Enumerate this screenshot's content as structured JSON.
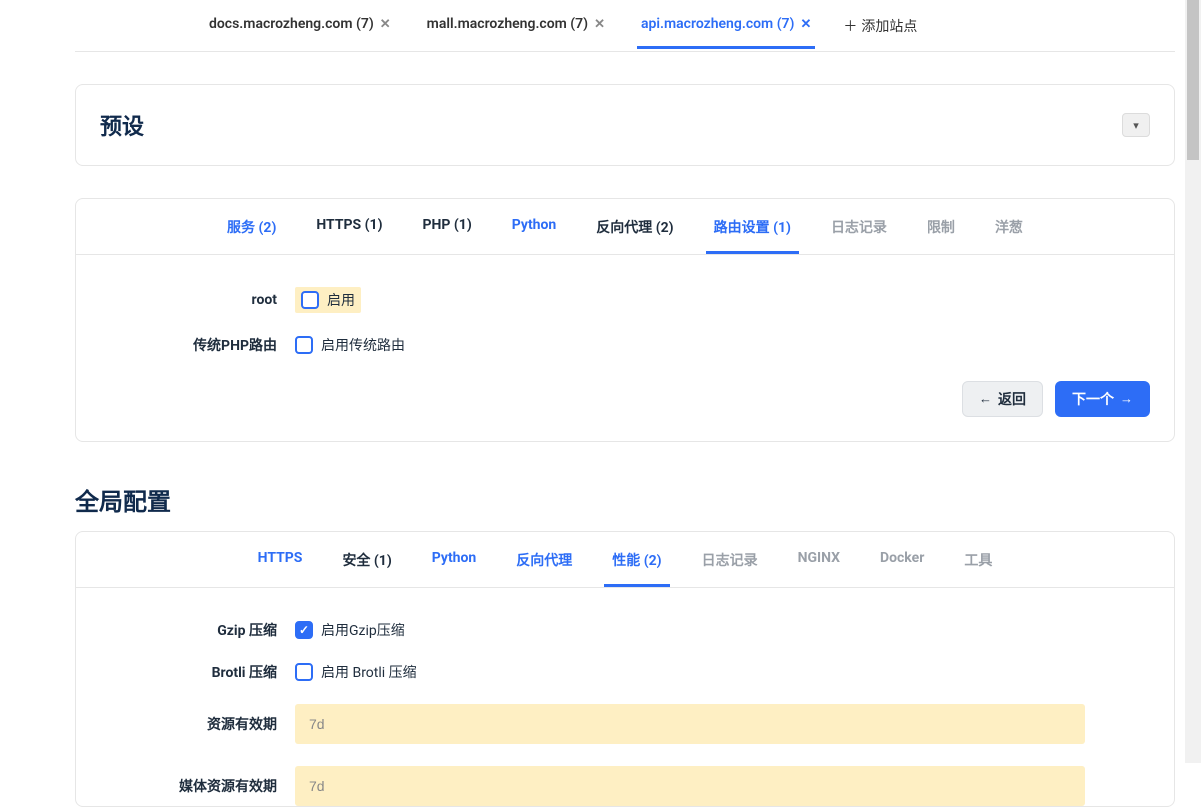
{
  "siteTabs": {
    "items": [
      {
        "label": "docs.macrozheng.com (7)",
        "active": false
      },
      {
        "label": "mall.macrozheng.com (7)",
        "active": false
      },
      {
        "label": "api.macrozheng.com (7)",
        "active": true
      }
    ],
    "addLabel": "添加站点"
  },
  "presetCard": {
    "title": "预设",
    "tabs": [
      {
        "label": "服务 (2)",
        "style": "link"
      },
      {
        "label": "HTTPS (1)",
        "style": "normal"
      },
      {
        "label": "PHP (1)",
        "style": "normal"
      },
      {
        "label": "Python",
        "style": "link"
      },
      {
        "label": "反向代理 (2)",
        "style": "normal"
      },
      {
        "label": "路由设置 (1)",
        "style": "active"
      },
      {
        "label": "日志记录",
        "style": "muted"
      },
      {
        "label": "限制",
        "style": "muted"
      },
      {
        "label": "洋葱",
        "style": "muted"
      }
    ],
    "rows": {
      "root": {
        "label": "root",
        "checkLabel": "启用",
        "checked": false,
        "highlight": true
      },
      "phpRoute": {
        "label": "传统PHP路由",
        "checkLabel": "启用传统路由",
        "checked": false,
        "highlight": false
      }
    },
    "buttons": {
      "back": "返回",
      "next": "下一个"
    }
  },
  "globalHeading": "全局配置",
  "globalCard": {
    "tabs": [
      {
        "label": "HTTPS",
        "style": "link"
      },
      {
        "label": "安全 (1)",
        "style": "normal"
      },
      {
        "label": "Python",
        "style": "link"
      },
      {
        "label": "反向代理",
        "style": "link"
      },
      {
        "label": "性能 (2)",
        "style": "active"
      },
      {
        "label": "日志记录",
        "style": "muted"
      },
      {
        "label": "NGINX",
        "style": "muted"
      },
      {
        "label": "Docker",
        "style": "muted"
      },
      {
        "label": "工具",
        "style": "muted"
      }
    ],
    "rows": {
      "gzip": {
        "label": "Gzip 压缩",
        "checkLabel": "启用Gzip压缩",
        "checked": true
      },
      "brotli": {
        "label": "Brotli 压缩",
        "checkLabel": "启用 Brotli 压缩",
        "checked": false
      },
      "assetExpire": {
        "label": "资源有效期",
        "value": "7d"
      },
      "mediaExpire": {
        "label": "媒体资源有效期",
        "value": "7d"
      }
    }
  }
}
